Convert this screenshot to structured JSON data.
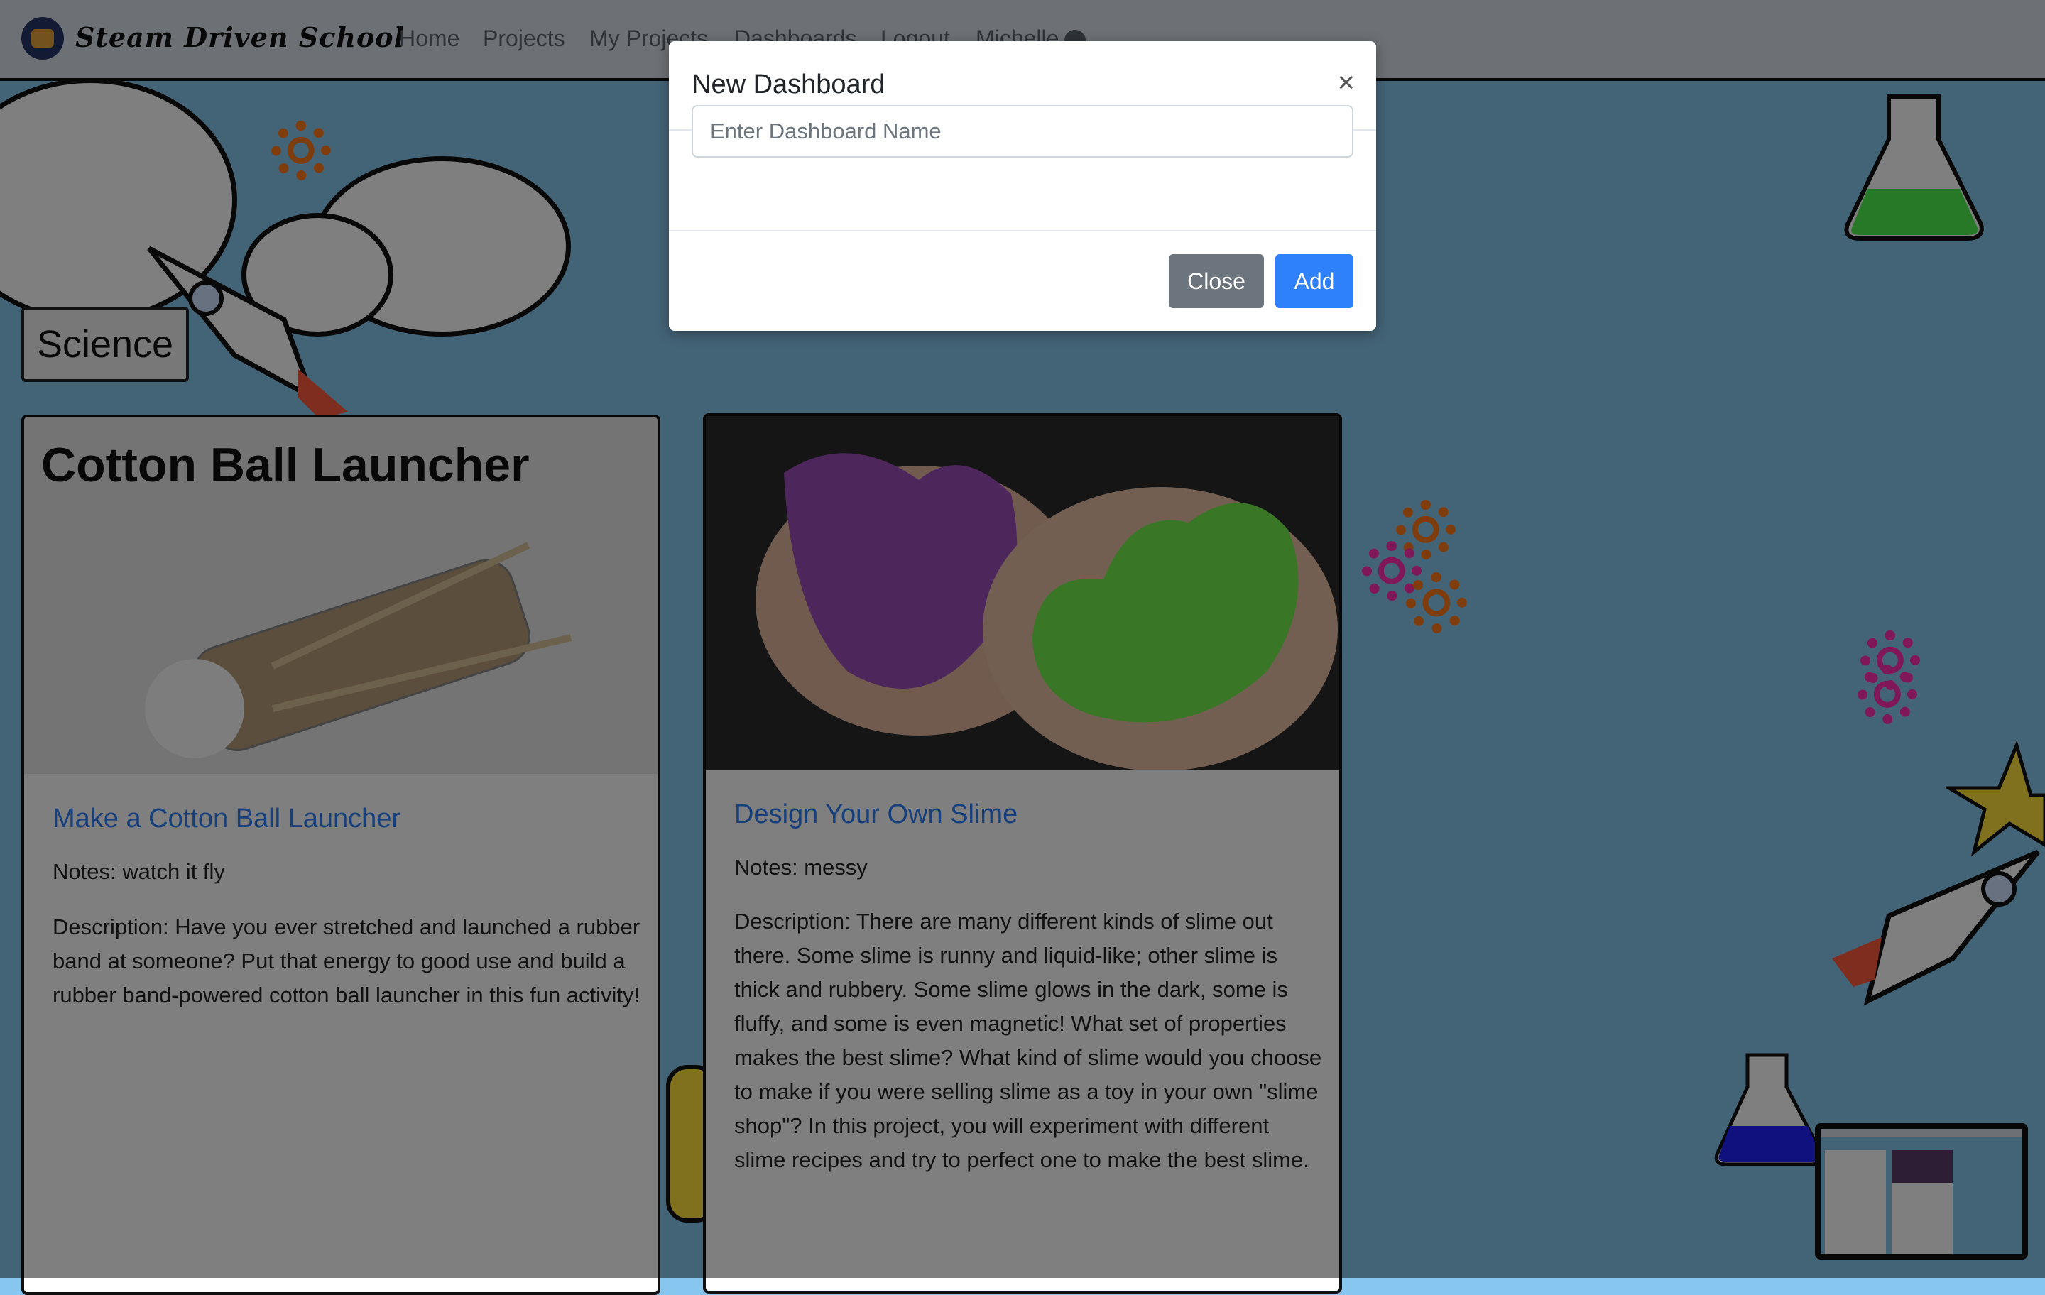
{
  "navbar": {
    "brand": "Steam Driven School",
    "links": [
      "Home",
      "Projects",
      "My Projects",
      "Dashboards",
      "Logout"
    ],
    "user": "Michelle"
  },
  "category_tag": "Science",
  "cards": [
    {
      "image_title": "Cotton Ball Launcher",
      "title": "Make a Cotton Ball Launcher",
      "notes": "Notes: watch it fly",
      "description": "Description: Have you ever stretched and launched a rubber band at someone? Put that energy to good use and build a rubber band-powered cotton ball launcher in this fun activity!"
    },
    {
      "title": "Design Your Own Slime",
      "notes": "Notes: messy",
      "description": "Description: There are many different kinds of slime out there. Some slime is runny and liquid-like; other slime is thick and rubbery. Some slime glows in the dark, some is fluffy, and some is even magnetic! What set of properties makes the best slime? What kind of slime would you choose to make if you were selling slime as a toy in your own \"slime shop\"? In this project, you will experiment with different slime recipes and try to perfect one to make the best slime."
    }
  ],
  "modal": {
    "title": "New Dashboard",
    "close_symbol": "×",
    "input_placeholder": "Enter Dashboard Name",
    "input_value": "",
    "close_label": "Close",
    "add_label": "Add"
  },
  "colors": {
    "background": "#87c7ef",
    "primary": "#2f80fb",
    "secondary": "#6c757d",
    "link": "#2d7ff9"
  },
  "icons": [
    "user-icon",
    "gear-icon",
    "rocket-icon",
    "cloud-icon",
    "flask-icon",
    "star-icon"
  ]
}
